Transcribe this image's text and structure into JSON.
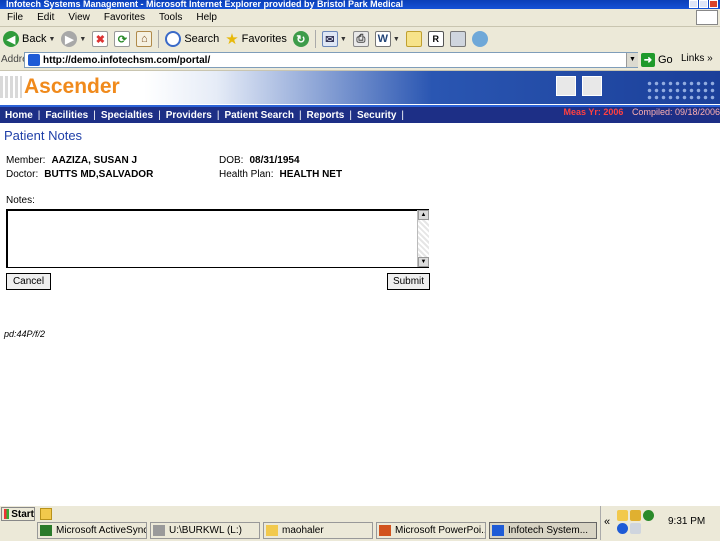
{
  "window": {
    "title": "Infotech Systems Management - Microsoft Internet Explorer provided by Bristol Park Medical"
  },
  "menu": [
    "File",
    "Edit",
    "View",
    "Favorites",
    "Tools",
    "Help"
  ],
  "toolbar": {
    "back": "Back",
    "search": "Search",
    "favorites": "Favorites"
  },
  "address": {
    "label": "Address",
    "url": "http://demo.infotechsm.com/portal/",
    "go": "Go",
    "links": "Links"
  },
  "banner": {
    "logo_text": "Ascender"
  },
  "nav": {
    "items": [
      "Home",
      "Facilities",
      "Specialties",
      "Providers",
      "Patient Search",
      "Reports",
      "Security"
    ],
    "meas_yr": "Meas Yr: 2006",
    "compiled": "Compiled: 09/18/2006"
  },
  "patient": {
    "title": "Patient Notes",
    "member_label": "Member:",
    "member_value": "AAZIZA, SUSAN J",
    "dob_label": "DOB:",
    "dob_value": "08/31/1954",
    "doctor_label": "Doctor:",
    "doctor_value": "BUTTS MD,SALVADOR",
    "plan_label": "Health Plan:",
    "plan_value": "HEALTH NET",
    "notes_label": "Notes:",
    "notes_value": "",
    "cancel": "Cancel",
    "submit": "Submit",
    "footer_id": "pd:44P/f/2"
  },
  "taskbar": {
    "start": "Start",
    "tasks": [
      "Microsoft ActiveSync",
      "U:\\BURKWL (L:)",
      "maohaler",
      "Microsoft PowerPoi...",
      "Infotech System..."
    ],
    "clock": "9:31 PM"
  },
  "colors": {
    "nav_bg": "#1d2f86",
    "title_blue": "#1f3fa8",
    "logo_orange": "#f08a1c",
    "meas_red": "#ff4040"
  }
}
